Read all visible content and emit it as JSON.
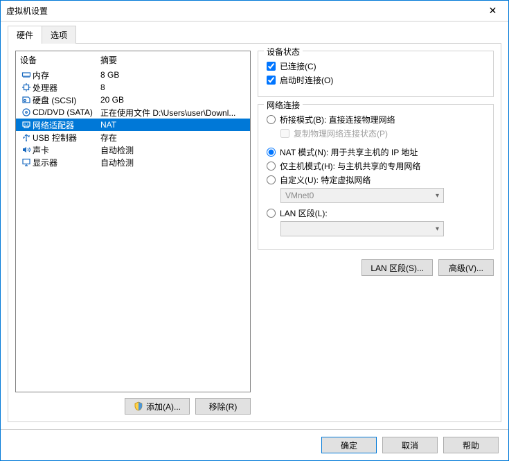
{
  "window": {
    "title": "虚拟机设置"
  },
  "tabs": {
    "hardware": "硬件",
    "options": "选项"
  },
  "device_list": {
    "header": {
      "device": "设备",
      "summary": "摘要"
    },
    "items": [
      {
        "name": "内存",
        "summary": "8 GB",
        "icon": "memory"
      },
      {
        "name": "处理器",
        "summary": "8",
        "icon": "cpu"
      },
      {
        "name": "硬盘 (SCSI)",
        "summary": "20 GB",
        "icon": "disk"
      },
      {
        "name": "CD/DVD (SATA)",
        "summary": "正在使用文件 D:\\Users\\user\\Downl...",
        "icon": "cd"
      },
      {
        "name": "网络适配器",
        "summary": "NAT",
        "icon": "net",
        "selected": true
      },
      {
        "name": "USB 控制器",
        "summary": "存在",
        "icon": "usb"
      },
      {
        "name": "声卡",
        "summary": "自动检测",
        "icon": "sound"
      },
      {
        "name": "显示器",
        "summary": "自动检测",
        "icon": "display"
      }
    ]
  },
  "left_buttons": {
    "add": "添加(A)...",
    "remove": "移除(R)"
  },
  "device_status": {
    "legend": "设备状态",
    "connected": "已连接(C)",
    "connect_at_poweron": "启动时连接(O)"
  },
  "network": {
    "legend": "网络连接",
    "bridged": "桥接模式(B): 直接连接物理网络",
    "replicate": "复制物理网络连接状态(P)",
    "nat": "NAT 模式(N): 用于共享主机的 IP 地址",
    "hostonly": "仅主机模式(H): 与主机共享的专用网络",
    "custom": "自定义(U): 特定虚拟网络",
    "custom_select": "VMnet0",
    "lanseg": "LAN 区段(L):",
    "lanseg_select": ""
  },
  "right_buttons": {
    "lanseg": "LAN 区段(S)...",
    "advanced": "高级(V)..."
  },
  "footer": {
    "ok": "确定",
    "cancel": "取消",
    "help": "帮助"
  }
}
